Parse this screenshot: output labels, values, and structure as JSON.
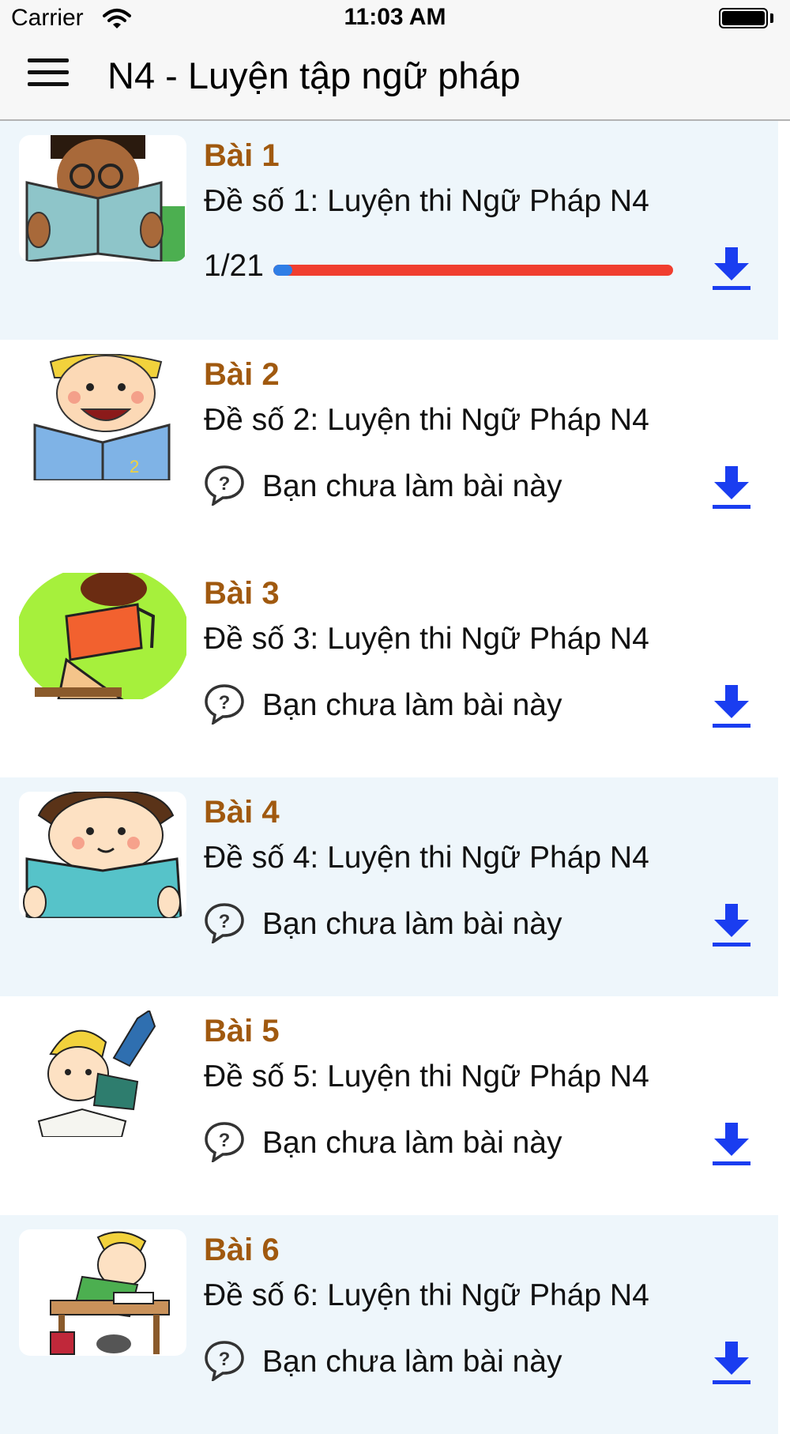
{
  "status_bar": {
    "carrier": "Carrier",
    "time": "11:03 AM"
  },
  "nav": {
    "title": "N4 - Luyện tập ngữ pháp",
    "menu_icon": "hamburger-menu-icon"
  },
  "colors": {
    "title_brown": "#a0590f",
    "progress_red": "#f03e2f",
    "progress_blue": "#2f7ee6",
    "download_blue": "#1a3df0",
    "alt_row_bg": "#eef6fb"
  },
  "lessons": [
    {
      "title": "Bài 1",
      "subtitle": "Đề số 1: Luyện thi Ngữ Pháp N4",
      "progress_text": "1/21",
      "progress_fraction": 0.0476,
      "download_icon": "download-icon"
    },
    {
      "title": "Bài 2",
      "subtitle": "Đề số 2: Luyện thi Ngữ Pháp N4",
      "status": "Bạn chưa làm bài này",
      "status_icon": "question-bubble-icon",
      "download_icon": "download-icon"
    },
    {
      "title": "Bài 3",
      "subtitle": "Đề số 3: Luyện thi Ngữ Pháp N4",
      "status": "Bạn chưa làm bài này",
      "status_icon": "question-bubble-icon",
      "download_icon": "download-icon"
    },
    {
      "title": "Bài 4",
      "subtitle": "Đề số 4: Luyện thi Ngữ Pháp N4",
      "status": "Bạn chưa làm bài này",
      "status_icon": "question-bubble-icon",
      "download_icon": "download-icon"
    },
    {
      "title": "Bài 5",
      "subtitle": "Đề số 5: Luyện thi Ngữ Pháp N4",
      "status": "Bạn chưa làm bài này",
      "status_icon": "question-bubble-icon",
      "download_icon": "download-icon"
    },
    {
      "title": "Bài 6",
      "subtitle": "Đề số 6: Luyện thi Ngữ Pháp N4",
      "status": "Bạn chưa làm bài này",
      "status_icon": "question-bubble-icon",
      "download_icon": "download-icon"
    }
  ]
}
